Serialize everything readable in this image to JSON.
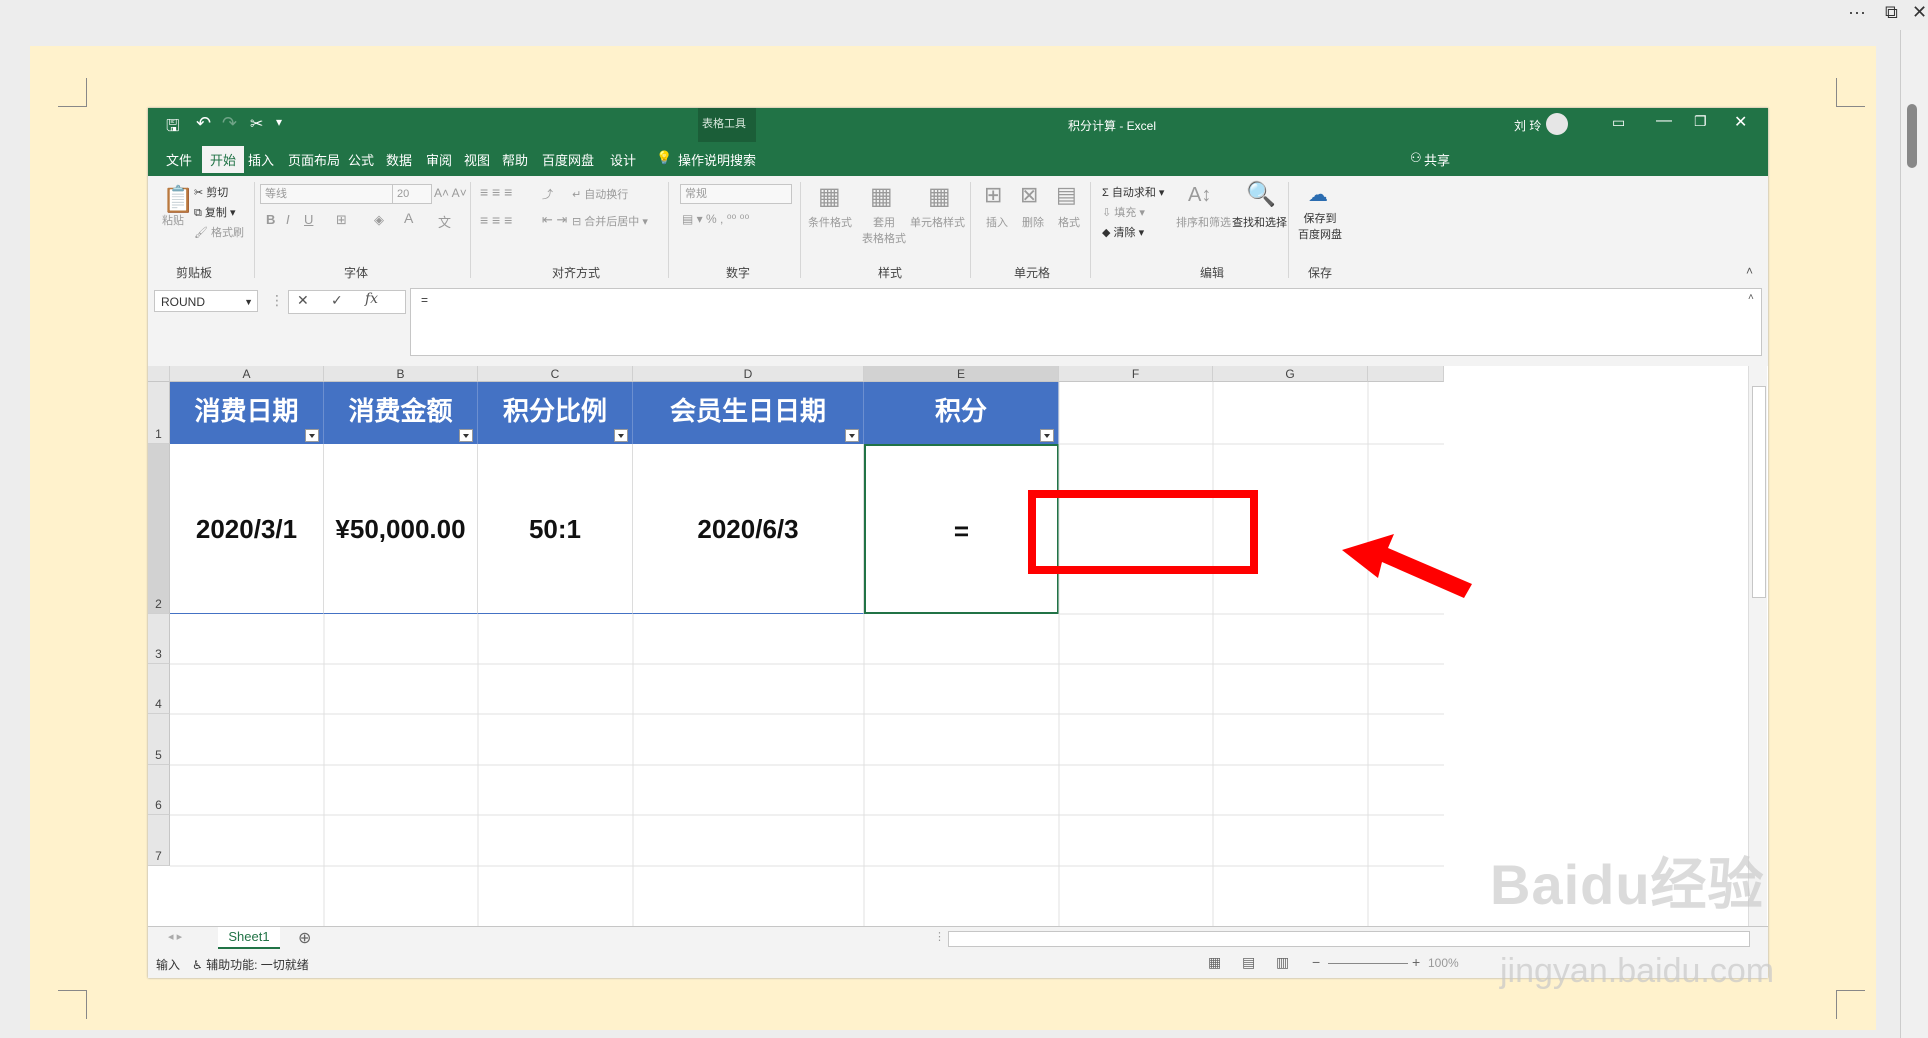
{
  "outer": {
    "more_icon": "···",
    "restore_icon": "⧉",
    "close_icon": "✕"
  },
  "excel": {
    "title": "积分计算 - Excel",
    "context_tab_group": "表格工具",
    "user_name": "刘 玲",
    "tabs": [
      "文件",
      "开始",
      "插入",
      "页面布局",
      "公式",
      "数据",
      "审阅",
      "视图",
      "帮助",
      "百度网盘",
      "设计"
    ],
    "tell_me": "操作说明搜索",
    "share": "共享",
    "ribbon": {
      "clipboard": {
        "paste": "粘贴",
        "cut": "剪切",
        "copy": "复制",
        "format_painter": "格式刷",
        "label": "剪贴板"
      },
      "font": {
        "font_name": "等线",
        "font_size": "20",
        "label": "字体"
      },
      "alignment": {
        "wrap": "自动换行",
        "merge": "合并后居中",
        "label": "对齐方式"
      },
      "number": {
        "format": "常规",
        "label": "数字"
      },
      "styles": {
        "conditional": "条件格式",
        "table": "套用\n表格格式",
        "cell_styles": "单元格样式",
        "label": "样式"
      },
      "cells": {
        "insert": "插入",
        "delete": "删除",
        "format": "格式",
        "label": "单元格"
      },
      "editing": {
        "autosum": "自动求和",
        "fill": "填充",
        "clear": "清除",
        "sort": "排序和筛选",
        "find": "查找和选择",
        "label": "编辑"
      },
      "save": {
        "save_to": "保存到\n百度网盘",
        "label": "保存"
      }
    },
    "name_box": "ROUND",
    "formula": "=",
    "columns": [
      "A",
      "B",
      "C",
      "D",
      "E",
      "F",
      "G"
    ],
    "rows": [
      "1",
      "2",
      "3",
      "4",
      "5",
      "6",
      "7"
    ],
    "headers": [
      "消费日期",
      "消费金额",
      "积分比例",
      "会员生日日期",
      "积分"
    ],
    "row2": [
      "2020/3/1",
      "¥50,000.00",
      "50:1",
      "2020/6/3",
      "="
    ],
    "sheet_tab": "Sheet1",
    "status_mode": "输入",
    "accessibility": "辅助功能: 一切就绪",
    "zoom": "100%"
  },
  "watermark": {
    "line1": "Baidu经验",
    "line2": "jingyan.baidu.com"
  },
  "colors": {
    "excel_green": "#217346",
    "header_blue": "#4472c4",
    "highlight_red": "#ff0000"
  }
}
